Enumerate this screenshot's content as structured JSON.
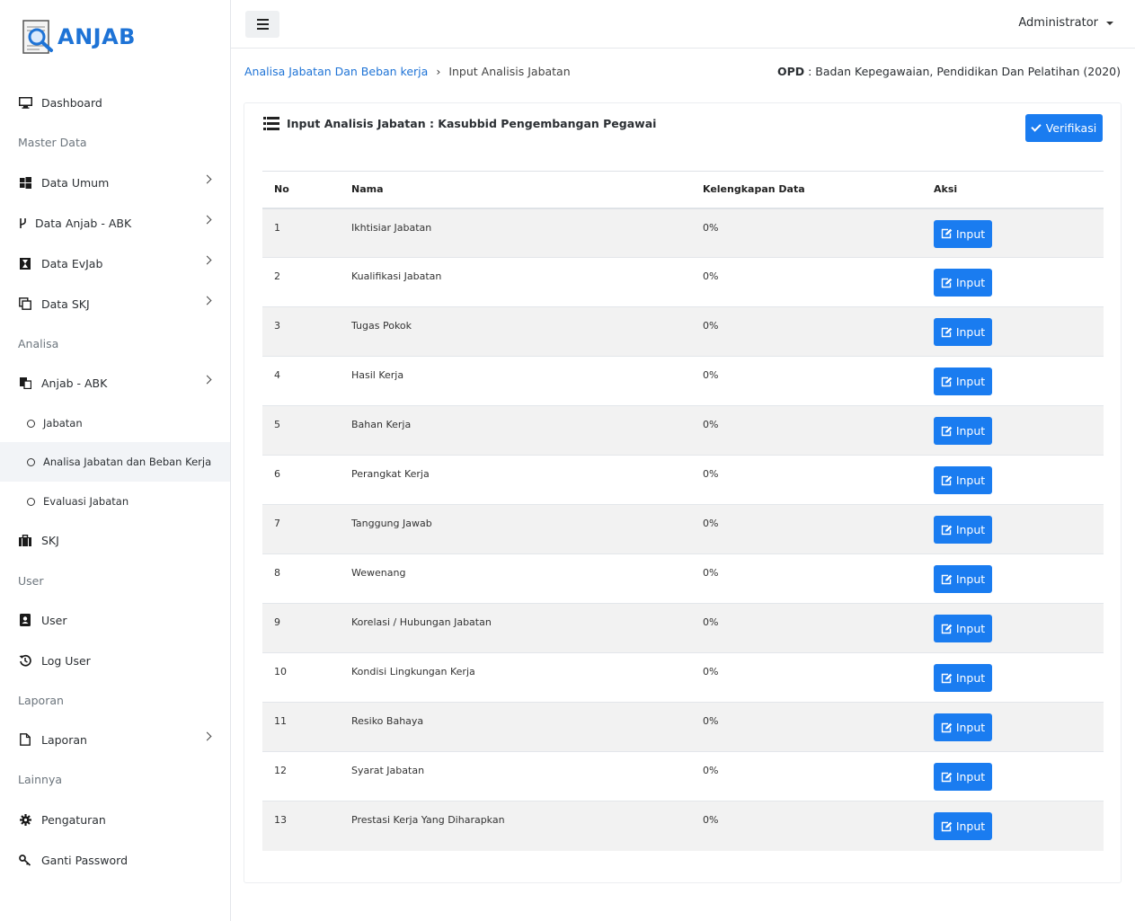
{
  "brand": {
    "name": "ANJAB"
  },
  "sidebar": {
    "items": [
      {
        "label": "Dashboard"
      },
      {
        "label": "Data Umum"
      },
      {
        "label": "Data Anjab - ABK"
      },
      {
        "label": "Data EvJab"
      },
      {
        "label": "Data SKJ"
      },
      {
        "label": "Anjab - ABK"
      },
      {
        "label": "Jabatan"
      },
      {
        "label": "Analisa Jabatan dan Beban Kerja"
      },
      {
        "label": "Evaluasi Jabatan"
      },
      {
        "label": "SKJ"
      },
      {
        "label": "User"
      },
      {
        "label": "Log User"
      },
      {
        "label": "Laporan"
      },
      {
        "label": "Pengaturan"
      },
      {
        "label": "Ganti Password"
      }
    ],
    "headers": [
      "Master Data",
      "Analisa",
      "User",
      "Laporan",
      "Lainnya"
    ]
  },
  "topbar": {
    "user": "Administrator"
  },
  "breadcrumb": {
    "parent": "Analisa Jabatan Dan Beban kerja",
    "separator": "›",
    "current": "Input Analisis Jabatan"
  },
  "opd": {
    "label": "OPD",
    "value": " : Badan Kepegawaian, Pendidikan Dan Pelatihan (2020)"
  },
  "card": {
    "title": "Input Analisis Jabatan : Kasubbid Pengembangan Pegawai",
    "verify_label": "Verifikasi"
  },
  "table": {
    "headers": [
      "No",
      "Nama",
      "Kelengkapan Data",
      "Aksi"
    ],
    "action_label": "Input",
    "rows": [
      {
        "no": "1",
        "nama": "Ikhtisiar Jabatan",
        "kelengkapan": "0%"
      },
      {
        "no": "2",
        "nama": "Kualifikasi Jabatan",
        "kelengkapan": "0%"
      },
      {
        "no": "3",
        "nama": "Tugas Pokok",
        "kelengkapan": "0%"
      },
      {
        "no": "4",
        "nama": "Hasil Kerja",
        "kelengkapan": "0%"
      },
      {
        "no": "5",
        "nama": "Bahan Kerja",
        "kelengkapan": "0%"
      },
      {
        "no": "6",
        "nama": "Perangkat Kerja",
        "kelengkapan": "0%"
      },
      {
        "no": "7",
        "nama": "Tanggung Jawab",
        "kelengkapan": "0%"
      },
      {
        "no": "8",
        "nama": "Wewenang",
        "kelengkapan": "0%"
      },
      {
        "no": "9",
        "nama": "Korelasi / Hubungan Jabatan",
        "kelengkapan": "0%"
      },
      {
        "no": "10",
        "nama": "Kondisi Lingkungan Kerja",
        "kelengkapan": "0%"
      },
      {
        "no": "11",
        "nama": "Resiko Bahaya",
        "kelengkapan": "0%"
      },
      {
        "no": "12",
        "nama": "Syarat Jabatan",
        "kelengkapan": "0%"
      },
      {
        "no": "13",
        "nama": "Prestasi Kerja Yang Diharapkan",
        "kelengkapan": "0%"
      }
    ]
  },
  "colors": {
    "primary": "#1a7cf0",
    "link": "#1e73d6",
    "stripe": "#f2f2f2"
  }
}
